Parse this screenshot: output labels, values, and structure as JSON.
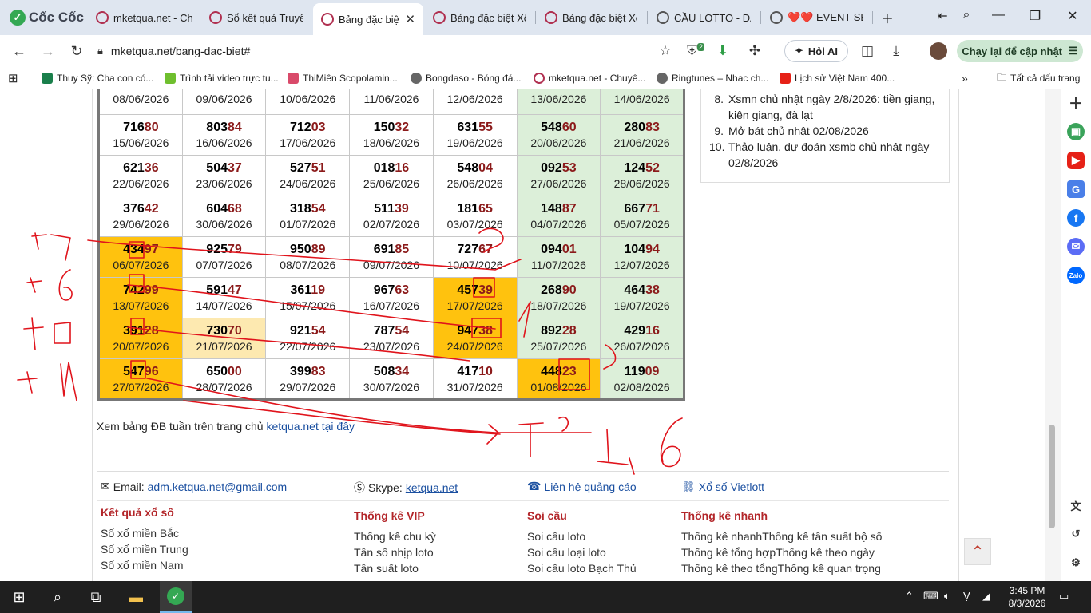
{
  "browser": {
    "brand": "Cốc Cốc",
    "tabs": [
      {
        "title": "mketqua.net - Ch",
        "icon": "mketqua-icon"
      },
      {
        "title": "Sổ kết quả Truyền",
        "icon": "mketqua-icon"
      },
      {
        "title": "Bảng đặc biệ",
        "icon": "mketqua-icon",
        "active": true
      },
      {
        "title": "Bảng đặc biệt Xổ",
        "icon": "mketqua-icon"
      },
      {
        "title": "Bảng đặc biệt Xổ",
        "icon": "mketqua-icon"
      },
      {
        "title": "CẦU LOTTO - ĐÀ",
        "icon": "globe-icon"
      },
      {
        "title": "❤️❤️ EVENT SE",
        "icon": "globe-icon"
      }
    ],
    "url": "mketqua.net/bang-dac-biet#",
    "extension_badge": "2",
    "ask_ai_label": "Hỏi AI",
    "update_label": "Chạy lại để cập nhật",
    "bookmarks": [
      "Thuy Sỹ: Cha con có...",
      "Trình tải video trực tu...",
      "ThiMiên Scopolamin...",
      "Bongdaso - Bóng đá...",
      "mketqua.net - Chuyê...",
      "Ringtunes – Nhac ch...",
      "Lịch sử Việt Nam 400..."
    ],
    "all_bookmarks_label": "Tất cả dấu trang"
  },
  "results": {
    "rows": [
      [
        {
          "head": "",
          "tail": "",
          "date": "08/06/2026"
        },
        {
          "head": "",
          "tail": "",
          "date": "09/06/2026"
        },
        {
          "head": "",
          "tail": "",
          "date": "10/06/2026"
        },
        {
          "head": "",
          "tail": "",
          "date": "11/06/2026"
        },
        {
          "head": "",
          "tail": "",
          "date": "12/06/2026"
        },
        {
          "head": "",
          "tail": "",
          "date": "13/06/2026"
        },
        {
          "head": "",
          "tail": "",
          "date": "14/06/2026"
        }
      ],
      [
        {
          "head": "716",
          "tail": "80",
          "date": "15/06/2026"
        },
        {
          "head": "803",
          "tail": "84",
          "date": "16/06/2026"
        },
        {
          "head": "712",
          "tail": "03",
          "date": "17/06/2026"
        },
        {
          "head": "150",
          "tail": "32",
          "date": "18/06/2026"
        },
        {
          "head": "631",
          "tail": "55",
          "date": "19/06/2026"
        },
        {
          "head": "548",
          "tail": "60",
          "date": "20/06/2026"
        },
        {
          "head": "280",
          "tail": "83",
          "date": "21/06/2026"
        }
      ],
      [
        {
          "head": "621",
          "tail": "36",
          "date": "22/06/2026"
        },
        {
          "head": "504",
          "tail": "37",
          "date": "23/06/2026"
        },
        {
          "head": "527",
          "tail": "51",
          "date": "24/06/2026"
        },
        {
          "head": "018",
          "tail": "16",
          "date": "25/06/2026"
        },
        {
          "head": "548",
          "tail": "04",
          "date": "26/06/2026"
        },
        {
          "head": "092",
          "tail": "53",
          "date": "27/06/2026"
        },
        {
          "head": "124",
          "tail": "52",
          "date": "28/06/2026"
        }
      ],
      [
        {
          "head": "376",
          "tail": "42",
          "date": "29/06/2026"
        },
        {
          "head": "604",
          "tail": "68",
          "date": "30/06/2026"
        },
        {
          "head": "318",
          "tail": "54",
          "date": "01/07/2026"
        },
        {
          "head": "511",
          "tail": "39",
          "date": "02/07/2026"
        },
        {
          "head": "181",
          "tail": "65",
          "date": "03/07/2026"
        },
        {
          "head": "148",
          "tail": "87",
          "date": "04/07/2026"
        },
        {
          "head": "667",
          "tail": "71",
          "date": "05/07/2026"
        }
      ],
      [
        {
          "head": "434",
          "tail": "97",
          "date": "06/07/2026",
          "hl": "orange"
        },
        {
          "head": "925",
          "tail": "79",
          "date": "07/07/2026"
        },
        {
          "head": "950",
          "tail": "89",
          "date": "08/07/2026"
        },
        {
          "head": "691",
          "tail": "85",
          "date": "09/07/2026"
        },
        {
          "head": "727",
          "tail": "67",
          "date": "10/07/2026"
        },
        {
          "head": "094",
          "tail": "01",
          "date": "11/07/2026"
        },
        {
          "head": "104",
          "tail": "94",
          "date": "12/07/2026"
        }
      ],
      [
        {
          "head": "742",
          "tail": "99",
          "date": "13/07/2026",
          "hl": "orange"
        },
        {
          "head": "591",
          "tail": "47",
          "date": "14/07/2026"
        },
        {
          "head": "361",
          "tail": "19",
          "date": "15/07/2026"
        },
        {
          "head": "967",
          "tail": "63",
          "date": "16/07/2026"
        },
        {
          "head": "457",
          "tail": "39",
          "date": "17/07/2026",
          "hl": "orange"
        },
        {
          "head": "268",
          "tail": "90",
          "date": "18/07/2026"
        },
        {
          "head": "464",
          "tail": "38",
          "date": "19/07/2026"
        }
      ],
      [
        {
          "head": "391",
          "tail": "28",
          "date": "20/07/2026",
          "hl": "orange"
        },
        {
          "head": "730",
          "tail": "70",
          "date": "21/07/2026",
          "hl": "light"
        },
        {
          "head": "921",
          "tail": "54",
          "date": "22/07/2026"
        },
        {
          "head": "787",
          "tail": "54",
          "date": "23/07/2026"
        },
        {
          "head": "947",
          "tail": "38",
          "date": "24/07/2026",
          "hl": "orange"
        },
        {
          "head": "892",
          "tail": "28",
          "date": "25/07/2026"
        },
        {
          "head": "429",
          "tail": "16",
          "date": "26/07/2026"
        }
      ],
      [
        {
          "head": "547",
          "tail": "96",
          "date": "27/07/2026",
          "hl": "orange"
        },
        {
          "head": "650",
          "tail": "00",
          "date": "28/07/2026"
        },
        {
          "head": "399",
          "tail": "83",
          "date": "29/07/2026"
        },
        {
          "head": "508",
          "tail": "34",
          "date": "30/07/2026"
        },
        {
          "head": "417",
          "tail": "10",
          "date": "31/07/2026"
        },
        {
          "head": "448",
          "tail": "23",
          "date": "01/08/2026",
          "hl": "orange"
        },
        {
          "head": "119",
          "tail": "09",
          "date": "02/08/2026"
        }
      ]
    ]
  },
  "week_note": {
    "text": "Xem bảng ĐB tuần trên trang chủ",
    "link": "ketqua.net tại đây"
  },
  "news": [
    {
      "index": "8.",
      "text": "Xsmn chủ nhật ngày 2/8/2026: tiền giang, kiên giang, đà lạt"
    },
    {
      "index": "9.",
      "text": "Mở bát chủ nhật 02/08/2026"
    },
    {
      "index": "10.",
      "text": "Thảo luận, dự đoán xsmb chủ nhật ngày 02/8/2026"
    }
  ],
  "contacts": {
    "email_label": "Email:",
    "email": "adm.ketqua.net@gmail.com",
    "skype_label": "Skype:",
    "skype": "ketqua.net",
    "ads": "Liên hệ quảng cáo",
    "vietlott": "Xổ số Vietlott"
  },
  "footer": {
    "col1": {
      "title": "Kết quả xổ số",
      "items": [
        "Số xố miền Bắc",
        "Số xố miền Trung",
        "Số xố miền Nam"
      ]
    },
    "col2": {
      "title": "Thống kê VIP",
      "items": [
        "Thống kê chu kỳ",
        "Tần số nhịp loto",
        "Tần suất loto"
      ]
    },
    "col3": {
      "title": "Soi cầu",
      "items": [
        "Soi cầu loto",
        "Soi cầu loại loto",
        "Soi cầu loto Bạch Thủ"
      ]
    },
    "col4": {
      "title": "Thống kê nhanh",
      "items": [
        "Thống kê nhanhThống kê tần suất bộ số",
        "Thống kê tổng hợpThống kê theo ngày",
        "Thống kê theo tổngThống kê quan trọng"
      ]
    }
  },
  "taskbar": {
    "time": "3:45 PM",
    "date": "8/3/2026"
  }
}
